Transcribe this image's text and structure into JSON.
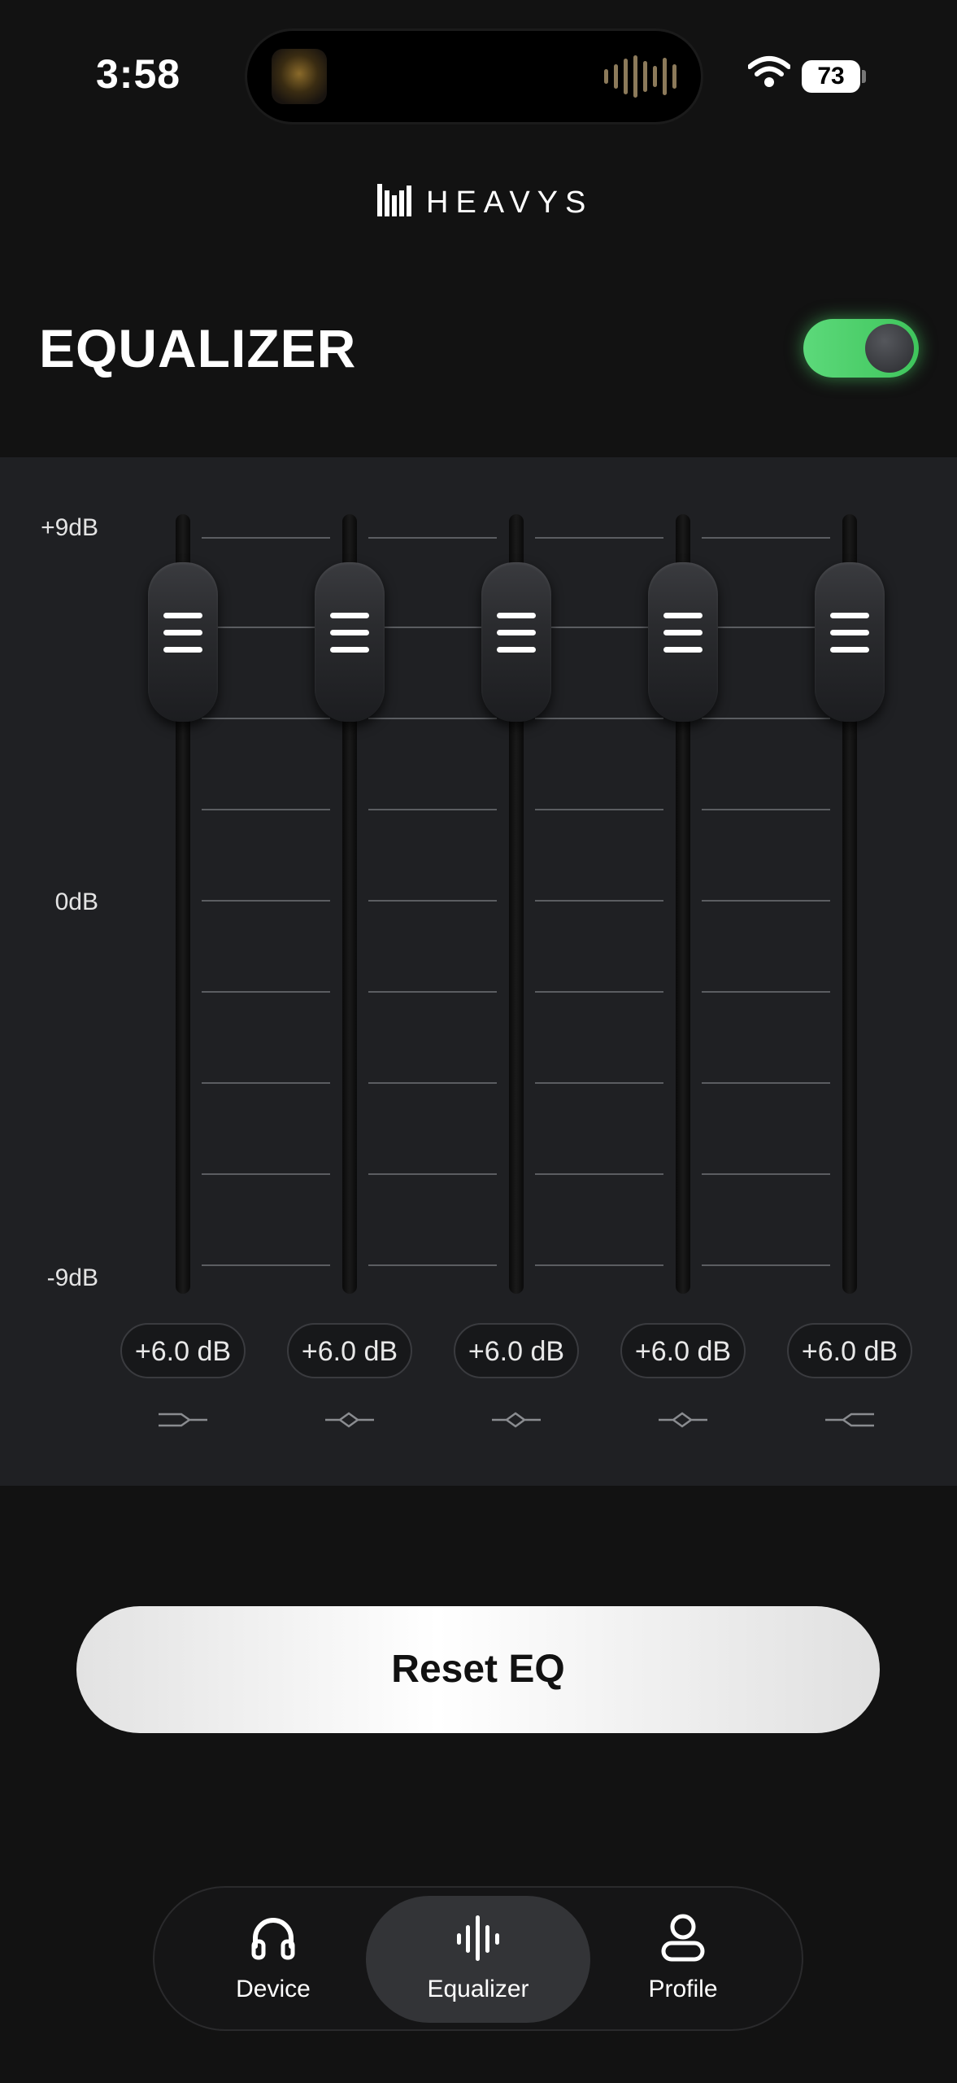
{
  "status_bar": {
    "time": "3:58",
    "battery": "73",
    "icons": [
      "album-art-icon",
      "waveform-icon",
      "wifi-icon",
      "battery-icon"
    ]
  },
  "brand": {
    "name": "HEAVYS"
  },
  "header": {
    "title": "EQUALIZER",
    "toggle_on": true,
    "toggle_color": "#4cd86c"
  },
  "eq": {
    "scale_labels": {
      "top": "+9dB",
      "mid": "0dB",
      "bottom": "-9dB"
    },
    "bands": [
      {
        "value_label": "+6.0 dB",
        "value_db": 6.0,
        "filter_icon": "low-shelf-icon"
      },
      {
        "value_label": "+6.0 dB",
        "value_db": 6.0,
        "filter_icon": "peak-icon"
      },
      {
        "value_label": "+6.0 dB",
        "value_db": 6.0,
        "filter_icon": "peak-icon"
      },
      {
        "value_label": "+6.0 dB",
        "value_db": 6.0,
        "filter_icon": "peak-icon"
      },
      {
        "value_label": "+6.0 dB",
        "value_db": 6.0,
        "filter_icon": "high-shelf-icon"
      }
    ]
  },
  "reset_button": {
    "label": "Reset EQ"
  },
  "tabs": [
    {
      "label": "Device",
      "icon": "headphones-icon",
      "active": false
    },
    {
      "label": "Equalizer",
      "icon": "waveform-icon",
      "active": true
    },
    {
      "label": "Profile",
      "icon": "user-icon",
      "active": false
    }
  ]
}
